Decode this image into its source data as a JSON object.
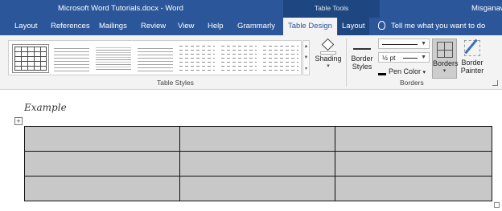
{
  "titlebar": {
    "document_title": "Microsoft Word Tutorials.docx  -  Word",
    "context_group": "Table Tools",
    "user_name": "Misganaw"
  },
  "tabs": [
    {
      "label": "Layout"
    },
    {
      "label": "References"
    },
    {
      "label": "Mailings"
    },
    {
      "label": "Review"
    },
    {
      "label": "View"
    },
    {
      "label": "Help"
    },
    {
      "label": "Grammarly"
    },
    {
      "label": "Table Design",
      "active": true
    },
    {
      "label": "Layout"
    }
  ],
  "tell_me": "Tell me what you want to do",
  "ribbon": {
    "table_styles_group": "Table Styles",
    "shading_label": "Shading",
    "border_styles_label_1": "Border",
    "border_styles_label_2": "Styles",
    "pen_weight": "½ pt",
    "pen_color_label": "Pen Color",
    "borders_label": "Borders",
    "painter_label_1": "Border",
    "painter_label_2": "Painter",
    "borders_group": "Borders"
  },
  "document": {
    "heading": "Example",
    "table": {
      "rows": 3,
      "columns": 3,
      "cell_fill": "#c8c8c8"
    }
  },
  "colors": {
    "ribbon_blue": "#2b579a",
    "context_blue": "#1e4680",
    "ribbon_bg": "#f3f3f3"
  }
}
